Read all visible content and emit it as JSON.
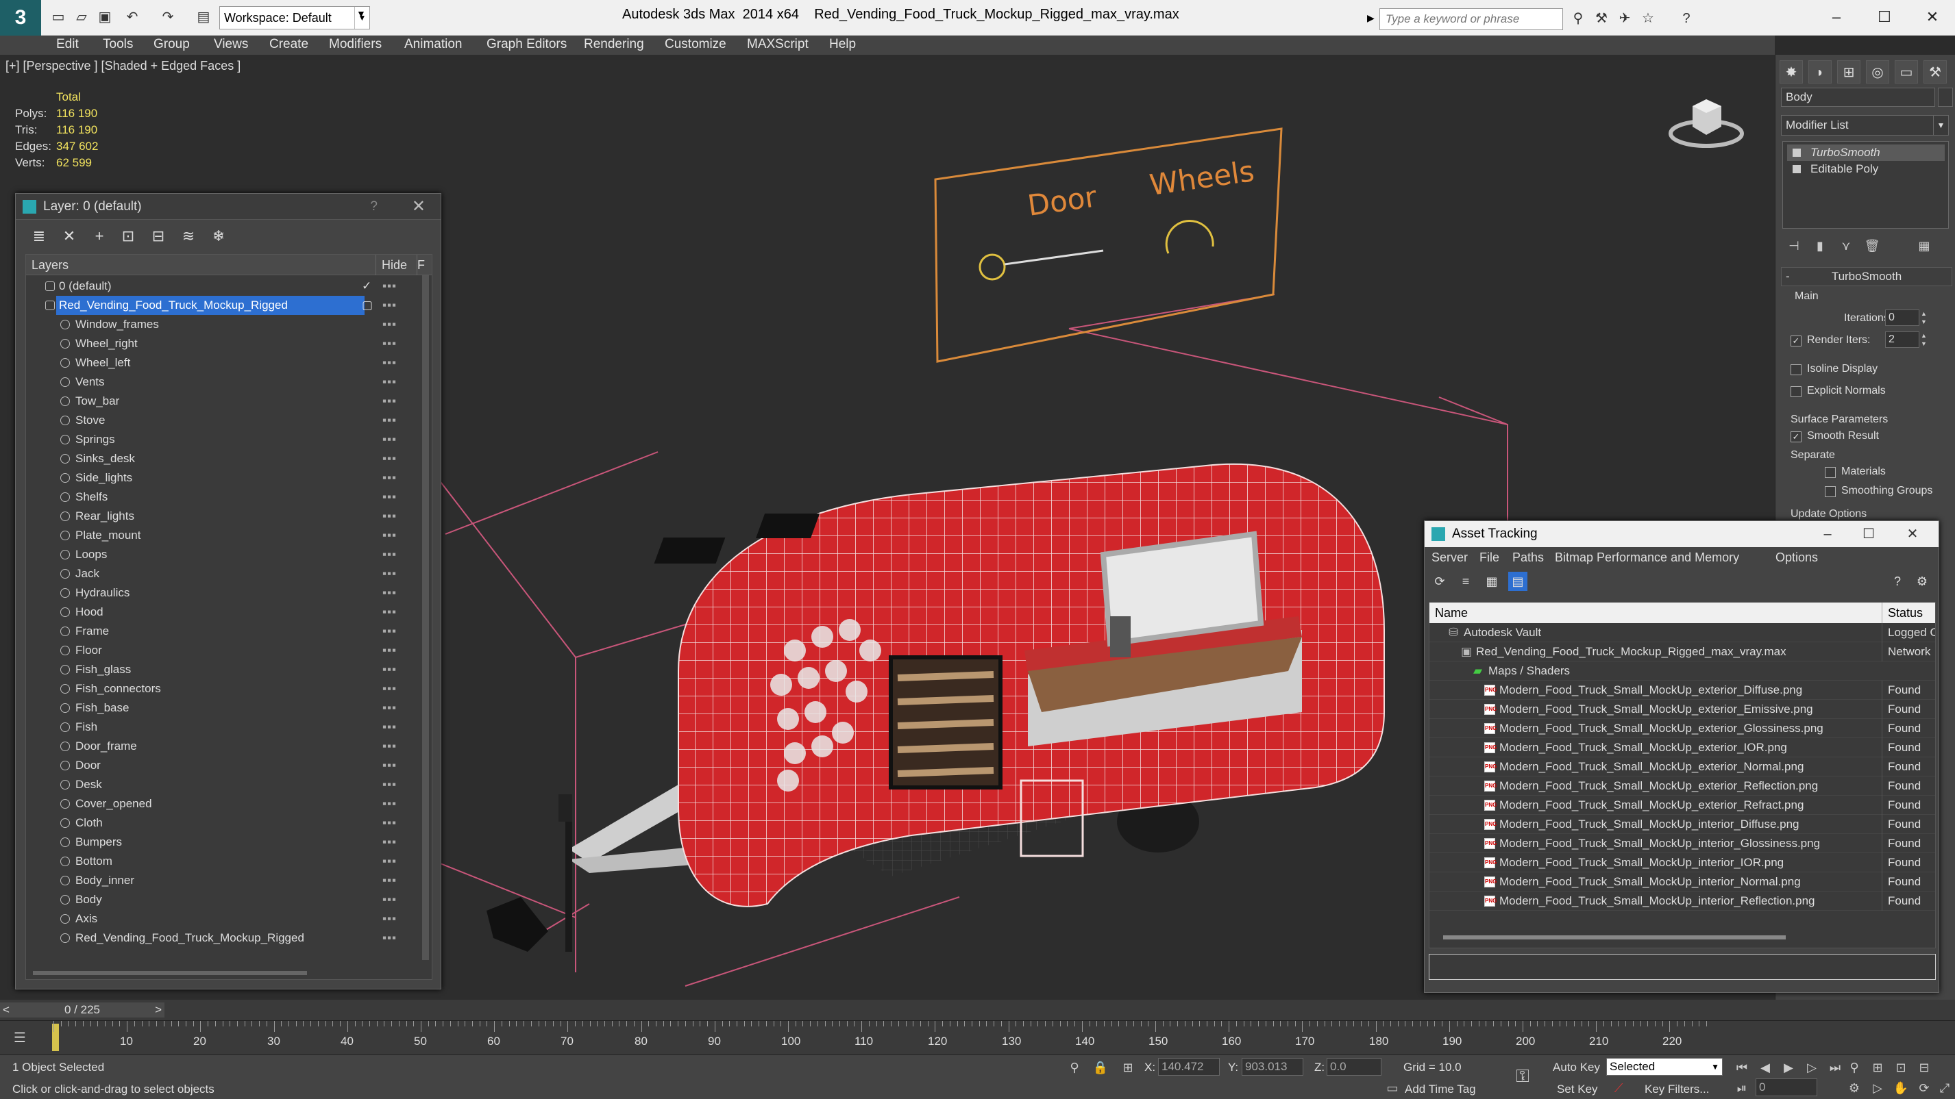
{
  "title": {
    "app": "Autodesk 3ds Max  2014 x64",
    "file": "Red_Vending_Food_Truck_Mockup_Rigged_max_vray.max",
    "workspace": "Workspace: Default",
    "search_placeholder": "Type a keyword or phrase"
  },
  "menu": [
    "Edit",
    "Tools",
    "Group",
    "Views",
    "Create",
    "Modifiers",
    "Animation",
    "Graph Editors",
    "Rendering",
    "Customize",
    "MAXScript",
    "Help"
  ],
  "viewport": {
    "label": "[+] [Perspective ] [Shaded + Edged Faces ]",
    "stats": {
      "header": "Total",
      "rows": [
        {
          "label": "Polys:",
          "value": "116 190"
        },
        {
          "label": "Tris:",
          "value": "116 190"
        },
        {
          "label": "Edges:",
          "value": "347 602"
        },
        {
          "label": "Verts:",
          "value": "62 599"
        }
      ]
    },
    "board_labels": {
      "door": "Door",
      "wheels": "Wheels"
    }
  },
  "layer_panel": {
    "title": "Layer: 0 (default)",
    "help": "?",
    "col_layers": "Layers",
    "col_hide": "Hide",
    "col_freeze": "F",
    "default_layer": "0 (default)",
    "selected_layer": "Red_Vending_Food_Truck_Mockup_Rigged",
    "objects": [
      "Window_frames",
      "Wheel_right",
      "Wheel_left",
      "Vents",
      "Tow_bar",
      "Stove",
      "Springs",
      "Sinks_desk",
      "Side_lights",
      "Shelfs",
      "Rear_lights",
      "Plate_mount",
      "Loops",
      "Jack",
      "Hydraulics",
      "Hood",
      "Frame",
      "Floor",
      "Fish_glass",
      "Fish_connectors",
      "Fish_base",
      "Fish",
      "Door_frame",
      "Door",
      "Desk",
      "Cover_opened",
      "Cloth",
      "Bumpers",
      "Bottom",
      "Body_inner",
      "Body",
      "Axis",
      "Red_Vending_Food_Truck_Mockup_Rigged"
    ]
  },
  "command_panel": {
    "object_name": "Body",
    "modifier_list": "Modifier List",
    "stack": [
      "TurboSmooth",
      "Editable Poly"
    ],
    "rollout": "TurboSmooth",
    "main": "Main",
    "iterations_label": "Iterations:",
    "iterations": "0",
    "render_iters_label": "Render Iters:",
    "render_iters": "2",
    "isoline": "Isoline Display",
    "explicit": "Explicit Normals",
    "surface": "Surface Parameters",
    "smooth": "Smooth Result",
    "separate": "Separate",
    "materials": "Materials",
    "smoothing": "Smoothing Groups",
    "update": "Update Options"
  },
  "asset_tracking": {
    "title": "Asset Tracking",
    "menu": [
      "Server",
      "File",
      "Paths",
      "Bitmap Performance and Memory",
      "Options"
    ],
    "col_name": "Name",
    "col_status": "Status",
    "vault": {
      "name": "Autodesk Vault",
      "status": "Logged Out"
    },
    "file": {
      "name": "Red_Vending_Food_Truck_Mockup_Rigged_max_vray.max",
      "status": "Network"
    },
    "maps": "Maps / Shaders",
    "file_badge": "PNG",
    "assets": [
      {
        "name": "Modern_Food_Truck_Small_MockUp_exterior_Diffuse.png",
        "status": "Found"
      },
      {
        "name": "Modern_Food_Truck_Small_MockUp_exterior_Emissive.png",
        "status": "Found"
      },
      {
        "name": "Modern_Food_Truck_Small_MockUp_exterior_Glossiness.png",
        "status": "Found"
      },
      {
        "name": "Modern_Food_Truck_Small_MockUp_exterior_IOR.png",
        "status": "Found"
      },
      {
        "name": "Modern_Food_Truck_Small_MockUp_exterior_Normal.png",
        "status": "Found"
      },
      {
        "name": "Modern_Food_Truck_Small_MockUp_exterior_Reflection.png",
        "status": "Found"
      },
      {
        "name": "Modern_Food_Truck_Small_MockUp_exterior_Refract.png",
        "status": "Found"
      },
      {
        "name": "Modern_Food_Truck_Small_MockUp_interior_Diffuse.png",
        "status": "Found"
      },
      {
        "name": "Modern_Food_Truck_Small_MockUp_interior_Glossiness.png",
        "status": "Found"
      },
      {
        "name": "Modern_Food_Truck_Small_MockUp_interior_IOR.png",
        "status": "Found"
      },
      {
        "name": "Modern_Food_Truck_Small_MockUp_interior_Normal.png",
        "status": "Found"
      },
      {
        "name": "Modern_Food_Truck_Small_MockUp_interior_Reflection.png",
        "status": "Found"
      }
    ]
  },
  "timeline": {
    "frame": "0 / 225",
    "prev": "<",
    "next": ">",
    "ticks": [
      "10",
      "20",
      "30",
      "40",
      "50",
      "60",
      "70",
      "80",
      "90",
      "100",
      "110",
      "120",
      "130",
      "140",
      "150",
      "160",
      "170",
      "180",
      "190",
      "200",
      "210",
      "220"
    ]
  },
  "status": {
    "selected": "1 Object Selected",
    "hint": "Click or click-and-drag to select objects",
    "x_label": "X:",
    "x": "140.472",
    "y_label": "Y:",
    "y": "903.013",
    "z_label": "Z:",
    "z": "0.0",
    "grid": "Grid = 10.0",
    "autokey": "Auto Key",
    "setkey": "Set Key",
    "selected_dd": "Selected",
    "keyfilters": "Key Filters...",
    "addtimetag": "Add Time Tag",
    "frame_field": "0"
  }
}
